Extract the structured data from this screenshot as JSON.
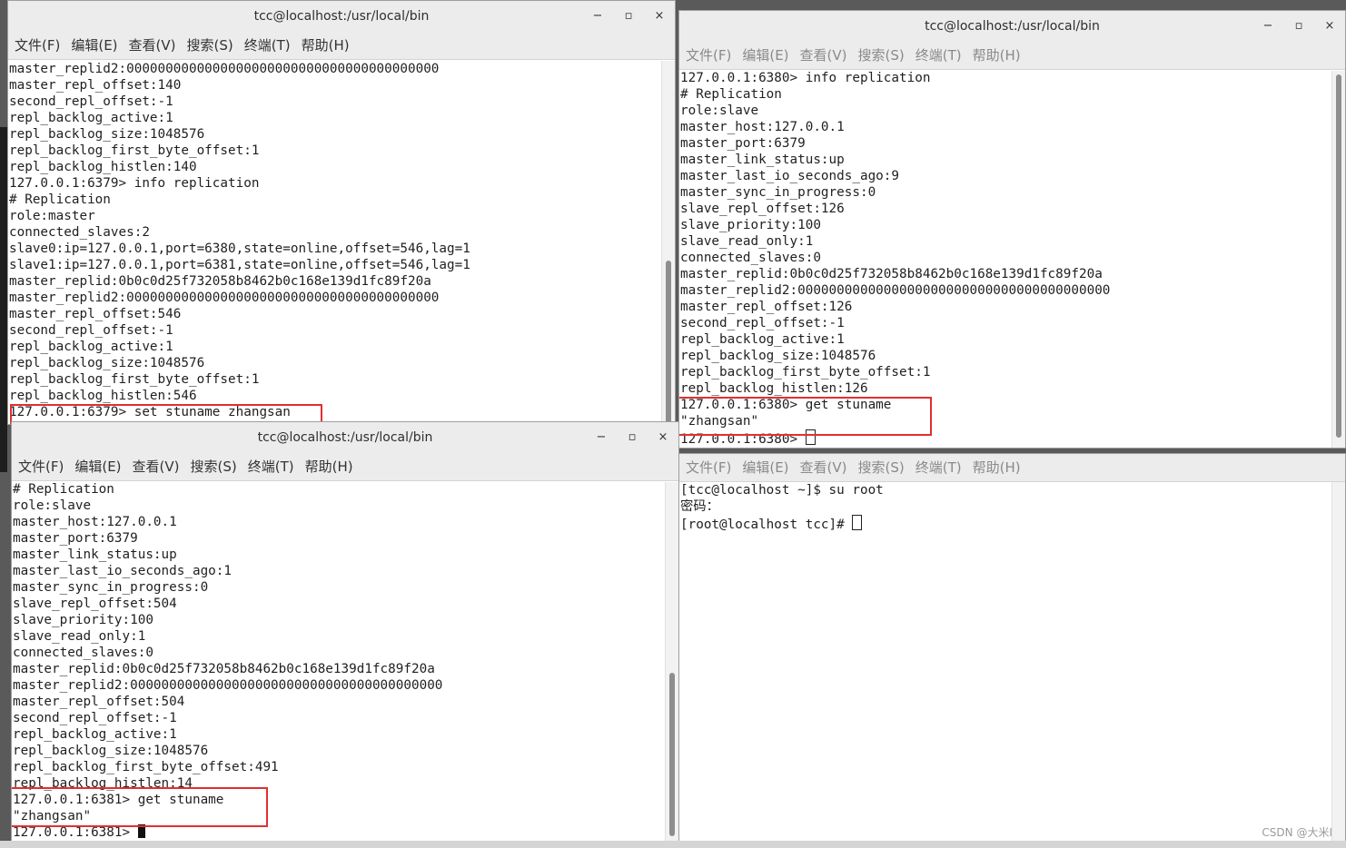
{
  "menu": [
    "文件(F)",
    "编辑(E)",
    "查看(V)",
    "搜索(S)",
    "终端(T)",
    "帮助(H)"
  ],
  "window_controls": {
    "minimize": "−",
    "maximize": "▫",
    "close": "×"
  },
  "windows": {
    "master": {
      "title": "tcc@localhost:/usr/local/bin",
      "lines": [
        "master_replid2:0000000000000000000000000000000000000000",
        "master_repl_offset:140",
        "second_repl_offset:-1",
        "repl_backlog_active:1",
        "repl_backlog_size:1048576",
        "repl_backlog_first_byte_offset:1",
        "repl_backlog_histlen:140",
        "127.0.0.1:6379> info replication",
        "# Replication",
        "role:master",
        "connected_slaves:2",
        "slave0:ip=127.0.0.1,port=6380,state=online,offset=546,lag=1",
        "slave1:ip=127.0.0.1,port=6381,state=online,offset=546,lag=1",
        "master_replid:0b0c0d25f732058b8462b0c168e139d1fc89f20a",
        "master_replid2:0000000000000000000000000000000000000000",
        "master_repl_offset:546",
        "second_repl_offset:-1",
        "repl_backlog_active:1",
        "repl_backlog_size:1048576",
        "repl_backlog_first_byte_offset:1",
        "repl_backlog_histlen:546",
        "127.0.0.1:6379> set stuname zhangsan"
      ]
    },
    "slave_6380": {
      "title": "tcc@localhost:/usr/local/bin",
      "lines": [
        "127.0.0.1:6380> info replication",
        "# Replication",
        "role:slave",
        "master_host:127.0.0.1",
        "master_port:6379",
        "master_link_status:up",
        "master_last_io_seconds_ago:9",
        "master_sync_in_progress:0",
        "slave_repl_offset:126",
        "slave_priority:100",
        "slave_read_only:1",
        "connected_slaves:0",
        "master_replid:0b0c0d25f732058b8462b0c168e139d1fc89f20a",
        "master_replid2:0000000000000000000000000000000000000000",
        "master_repl_offset:126",
        "second_repl_offset:-1",
        "repl_backlog_active:1",
        "repl_backlog_size:1048576",
        "repl_backlog_first_byte_offset:1",
        "repl_backlog_histlen:126",
        "127.0.0.1:6380> get stuname",
        "\"zhangsan\""
      ],
      "prompt": "127.0.0.1:6380> "
    },
    "slave_6381": {
      "title": "tcc@localhost:/usr/local/bin",
      "lines": [
        "# Replication",
        "role:slave",
        "master_host:127.0.0.1",
        "master_port:6379",
        "master_link_status:up",
        "master_last_io_seconds_ago:1",
        "master_sync_in_progress:0",
        "slave_repl_offset:504",
        "slave_priority:100",
        "slave_read_only:1",
        "connected_slaves:0",
        "master_replid:0b0c0d25f732058b8462b0c168e139d1fc89f20a",
        "master_replid2:0000000000000000000000000000000000000000",
        "master_repl_offset:504",
        "second_repl_offset:-1",
        "repl_backlog_active:1",
        "repl_backlog_size:1048576",
        "repl_backlog_first_byte_offset:491",
        "repl_backlog_histlen:14",
        "127.0.0.1:6381> get stuname",
        "\"zhangsan\""
      ],
      "prompt": "127.0.0.1:6381> "
    },
    "shell": {
      "lines": [
        "[tcc@localhost ~]$ su root",
        "密码："
      ],
      "prompt": "[root@localhost tcc]# "
    }
  },
  "watermark": "CSDN @大米I"
}
